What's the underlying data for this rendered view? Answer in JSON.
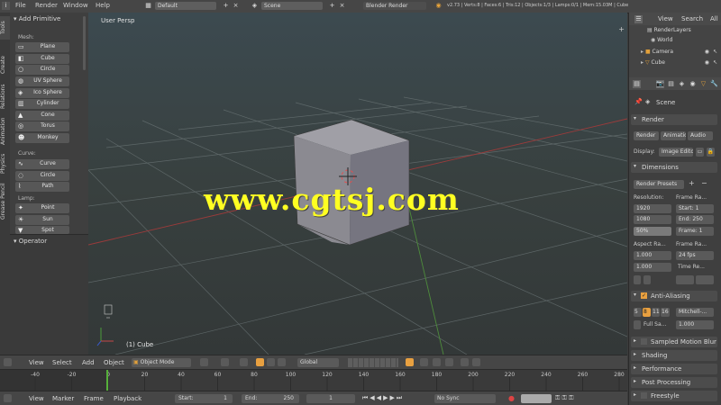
{
  "topbar": {
    "menus": [
      "File",
      "Render",
      "Window",
      "Help"
    ],
    "layout_field": "Default",
    "scene_field": "Scene",
    "engine": "Blender Render",
    "stats": "v2.73 | Verts:8 | Faces:6 | Tris:12 | Objects:1/3 | Lamps:0/1 | Mem:15.03M | Cube"
  },
  "left_tabs": [
    "Tools",
    "Create",
    "Relations",
    "Animation",
    "Physics",
    "Grease Pencil"
  ],
  "toolshelf": {
    "panel_title": "Add Primitive",
    "mesh_label": "Mesh:",
    "mesh_items": [
      "Plane",
      "Cube",
      "Circle",
      "UV Sphere",
      "Ico Sphere",
      "Cylinder",
      "Cone",
      "Torus",
      "Monkey"
    ],
    "curve_label": "Curve:",
    "curve_items": [
      "Curve",
      "Circle",
      "Path"
    ],
    "lamp_label": "Lamp:",
    "lamp_items": [
      "Point",
      "Sun",
      "Spot"
    ],
    "operator_title": "Operator"
  },
  "viewport": {
    "view_label": "User Persp",
    "object_label": "(1) Cube",
    "watermark": "www.cgtsj.com",
    "cube_color": "#8e8c93",
    "bg_color": "#3c4a50"
  },
  "outliner": {
    "menus": [
      "View",
      "Search",
      "All"
    ],
    "items": [
      "RenderLayers",
      "World",
      "Camera",
      "Cube"
    ]
  },
  "properties": {
    "context": "Scene",
    "render_panel": "Render",
    "render_buttons": [
      "Render",
      "Animation",
      "Audio"
    ],
    "display_label": "Display:",
    "display_value": "Image Editor",
    "dimensions_panel": "Dimensions",
    "presets": "Render Presets",
    "resolution_label": "Resolution:",
    "res_x": "1920",
    "res_y": "1080",
    "res_pct": "50%",
    "frame_range_label": "Frame Ra...",
    "start": "Start: 1",
    "end": "End: 250",
    "step": "Frame: 1",
    "aspect_label": "Aspect Ra...",
    "aspect_x": "1.000",
    "aspect_y": "1.000",
    "frame_rate_label": "Frame Ra...",
    "fps": "24 fps",
    "time_remap": "Time Re...",
    "aa_panel": "Anti-Aliasing",
    "aa_samples": [
      "5",
      "8",
      "11",
      "16"
    ],
    "full_sample": "Full Sa...",
    "filter": "Mitchell-...",
    "filter_size": "1.000",
    "collapsed_panels": [
      "Sampled Motion Blur",
      "Shading",
      "Performance",
      "Post Processing",
      "Freestyle"
    ]
  },
  "view_header": {
    "menus": [
      "View",
      "Select",
      "Add",
      "Object"
    ],
    "mode": "Object Mode",
    "pivot": "Global"
  },
  "timeline": {
    "ticks": [
      "-40",
      "-20",
      "0",
      "20",
      "40",
      "60",
      "80",
      "100",
      "120",
      "140",
      "160",
      "180",
      "200",
      "220",
      "240",
      "260",
      "280"
    ],
    "menus": [
      "View",
      "Marker",
      "Frame",
      "Playback"
    ],
    "start": "Start:",
    "start_val": "1",
    "end": "End:",
    "end_val": "250",
    "current": "1",
    "sync": "No Sync"
  }
}
